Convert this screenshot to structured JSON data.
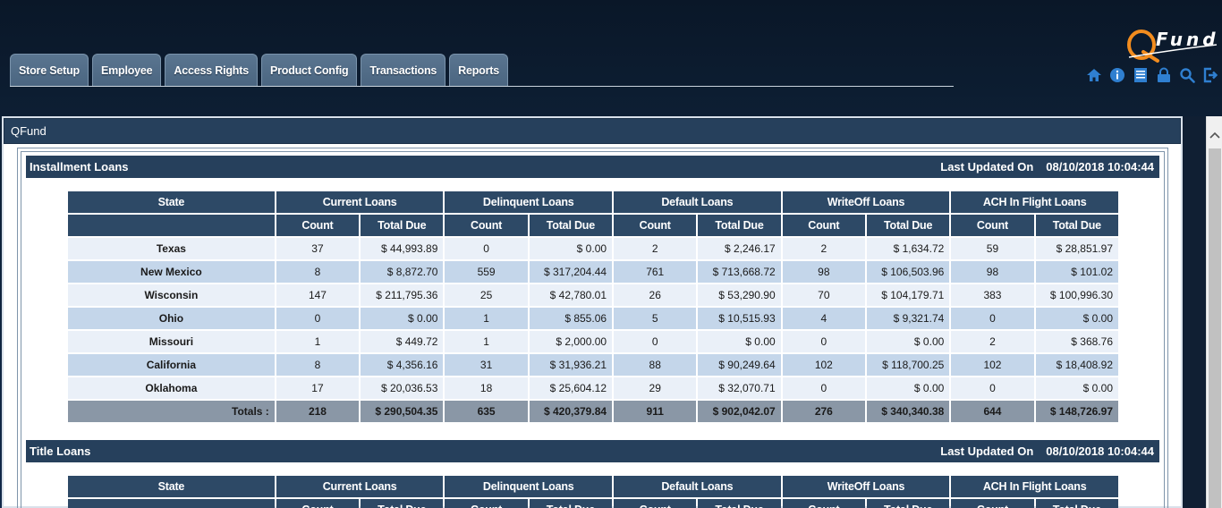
{
  "nav": {
    "tabs": [
      "Store Setup",
      "Employee",
      "Access Rights",
      "Product Config",
      "Transactions",
      "Reports"
    ]
  },
  "logo": {
    "text": "Fund",
    "accent": "#f28c1e"
  },
  "toolbar": {
    "icons": [
      "home-icon",
      "info-icon",
      "list-icon",
      "lock-icon",
      "search-icon",
      "logout-icon"
    ],
    "color": "#2f7fd0"
  },
  "panel": {
    "title": "QFund"
  },
  "columns": {
    "state": "State",
    "groups": [
      "Current Loans",
      "Delinquent Loans",
      "Default Loans",
      "WriteOff Loans",
      "ACH In Flight Loans"
    ],
    "count": "Count",
    "total_due": "Total Due"
  },
  "installment": {
    "title": "Installment Loans",
    "updated_label": "Last Updated On",
    "updated_value": "08/10/2018 10:04:44",
    "rows": [
      {
        "state": "Texas",
        "v": [
          "37",
          "$ 44,993.89",
          "0",
          "$ 0.00",
          "2",
          "$ 2,246.17",
          "2",
          "$ 1,634.72",
          "59",
          "$ 28,851.97"
        ]
      },
      {
        "state": "New Mexico",
        "v": [
          "8",
          "$ 8,872.70",
          "559",
          "$ 317,204.44",
          "761",
          "$ 713,668.72",
          "98",
          "$ 106,503.96",
          "98",
          "$ 101.02"
        ]
      },
      {
        "state": "Wisconsin",
        "v": [
          "147",
          "$ 211,795.36",
          "25",
          "$ 42,780.01",
          "26",
          "$ 53,290.90",
          "70",
          "$ 104,179.71",
          "383",
          "$ 100,996.30"
        ]
      },
      {
        "state": "Ohio",
        "v": [
          "0",
          "$ 0.00",
          "1",
          "$ 855.06",
          "5",
          "$ 10,515.93",
          "4",
          "$ 9,321.74",
          "0",
          "$ 0.00"
        ]
      },
      {
        "state": "Missouri",
        "v": [
          "1",
          "$ 449.72",
          "1",
          "$ 2,000.00",
          "0",
          "$ 0.00",
          "0",
          "$ 0.00",
          "2",
          "$ 368.76"
        ]
      },
      {
        "state": "California",
        "v": [
          "8",
          "$ 4,356.16",
          "31",
          "$ 31,936.21",
          "88",
          "$ 90,249.64",
          "102",
          "$ 118,700.25",
          "102",
          "$ 18,408.92"
        ]
      },
      {
        "state": "Oklahoma",
        "v": [
          "17",
          "$ 20,036.53",
          "18",
          "$ 25,604.12",
          "29",
          "$ 32,070.71",
          "0",
          "$ 0.00",
          "0",
          "$ 0.00"
        ]
      }
    ],
    "totals_label": "Totals :",
    "totals": [
      "218",
      "$ 290,504.35",
      "635",
      "$ 420,379.84",
      "911",
      "$ 902,042.07",
      "276",
      "$ 340,340.38",
      "644",
      "$ 148,726.97"
    ]
  },
  "title_loans": {
    "title": "Title Loans",
    "updated_label": "Last Updated On",
    "updated_value": "08/10/2018 10:04:44"
  }
}
